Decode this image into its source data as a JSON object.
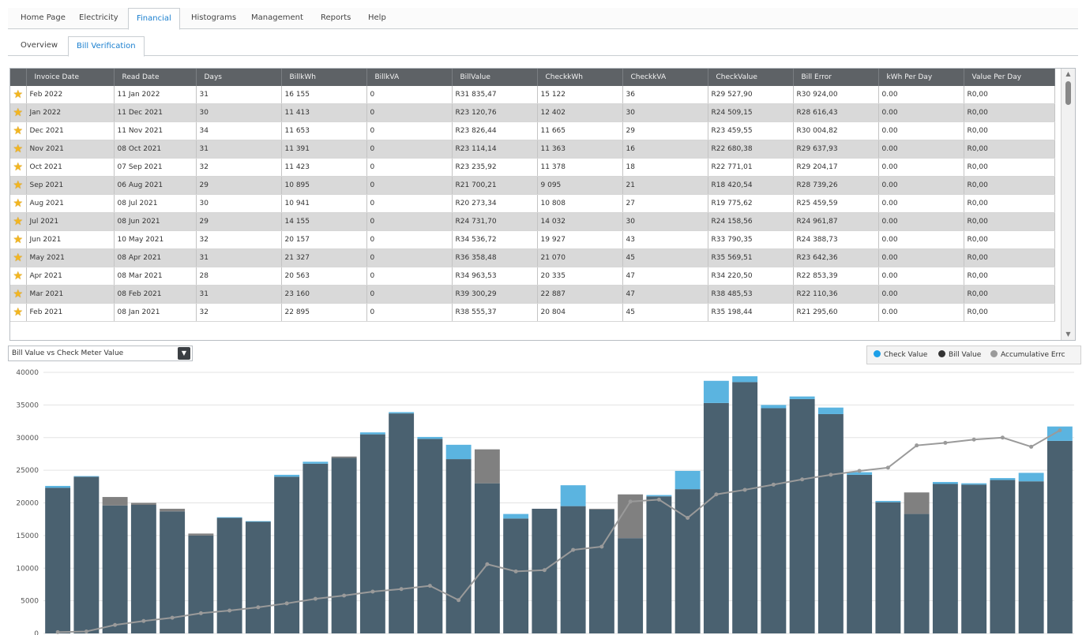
{
  "nav": {
    "tabs": [
      {
        "label": "Home Page"
      },
      {
        "label": "Electricity"
      },
      {
        "label": "Financial"
      },
      {
        "label": "Histograms"
      },
      {
        "label": "Management"
      },
      {
        "label": "Reports"
      },
      {
        "label": "Help"
      }
    ],
    "active": "Financial"
  },
  "subnav": {
    "tabs": [
      {
        "label": "Overview"
      },
      {
        "label": "Bill Verification"
      }
    ],
    "active": "Bill Verification"
  },
  "table": {
    "columns": [
      "Invoice Date",
      "Read Date",
      "Days",
      "BillkWh",
      "BillkVA",
      "BillValue",
      "CheckkWh",
      "CheckkVA",
      "CheckValue",
      "Bill Error",
      "kWh Per Day",
      "Value Per Day"
    ],
    "rows": [
      [
        "Feb 2022",
        "11 Jan 2022",
        "31",
        "16 155",
        "0",
        "R31 835,47",
        "15 122",
        "36",
        "R29 527,90",
        "R30 924,00",
        "0.00",
        "R0,00"
      ],
      [
        "Jan 2022",
        "11 Dec 2021",
        "30",
        "11 413",
        "0",
        "R23 120,76",
        "12 402",
        "30",
        "R24 509,15",
        "R28 616,43",
        "0.00",
        "R0,00"
      ],
      [
        "Dec 2021",
        "11 Nov 2021",
        "34",
        "11 653",
        "0",
        "R23 826,44",
        "11 665",
        "29",
        "R23 459,55",
        "R30 004,82",
        "0.00",
        "R0,00"
      ],
      [
        "Nov 2021",
        "08 Oct 2021",
        "31",
        "11 391",
        "0",
        "R23 114,14",
        "11 363",
        "16",
        "R22 680,38",
        "R29 637,93",
        "0.00",
        "R0,00"
      ],
      [
        "Oct 2021",
        "07 Sep 2021",
        "32",
        "11 423",
        "0",
        "R23 235,92",
        "11 378",
        "18",
        "R22 771,01",
        "R29 204,17",
        "0.00",
        "R0,00"
      ],
      [
        "Sep 2021",
        "06 Aug 2021",
        "29",
        "10 895",
        "0",
        "R21 700,21",
        "9 095",
        "21",
        "R18 420,54",
        "R28 739,26",
        "0.00",
        "R0,00"
      ],
      [
        "Aug 2021",
        "08 Jul 2021",
        "30",
        "10 941",
        "0",
        "R20 273,34",
        "10 808",
        "27",
        "R19 775,62",
        "R25 459,59",
        "0.00",
        "R0,00"
      ],
      [
        "Jul 2021",
        "08 Jun 2021",
        "29",
        "14 155",
        "0",
        "R24 731,70",
        "14 032",
        "30",
        "R24 158,56",
        "R24 961,87",
        "0.00",
        "R0,00"
      ],
      [
        "Jun 2021",
        "10 May 2021",
        "32",
        "20 157",
        "0",
        "R34 536,72",
        "19 927",
        "43",
        "R33 790,35",
        "R24 388,73",
        "0.00",
        "R0,00"
      ],
      [
        "May 2021",
        "08 Apr 2021",
        "31",
        "21 327",
        "0",
        "R36 358,48",
        "21 070",
        "45",
        "R35 569,51",
        "R23 642,36",
        "0.00",
        "R0,00"
      ],
      [
        "Apr 2021",
        "08 Mar 2021",
        "28",
        "20 563",
        "0",
        "R34 963,53",
        "20 335",
        "47",
        "R34 220,50",
        "R22 853,39",
        "0.00",
        "R0,00"
      ],
      [
        "Mar 2021",
        "08 Feb 2021",
        "31",
        "23 160",
        "0",
        "R39 300,29",
        "22 887",
        "47",
        "R38 485,53",
        "R22 110,36",
        "0.00",
        "R0,00"
      ],
      [
        "Feb 2021",
        "08 Jan 2021",
        "32",
        "22 895",
        "0",
        "R38 555,37",
        "20 804",
        "45",
        "R35 198,44",
        "R21 295,60",
        "0.00",
        "R0,00"
      ]
    ]
  },
  "selector": {
    "value": "Bill Value vs Check Meter Value"
  },
  "legend": {
    "check": "Check Value",
    "bill": "Bill Value",
    "accum": "Accumulative Errc"
  },
  "colors": {
    "bill": "#4a6170",
    "check": "#5bb4e0",
    "accum": "#808080",
    "header": "#5e6266",
    "active_tab": "#1a7fcf"
  },
  "chart_data": {
    "type": "bar",
    "ylim": [
      0,
      40000
    ],
    "yticks": [
      0,
      5000,
      10000,
      15000,
      20000,
      25000,
      30000,
      35000,
      40000
    ],
    "series": [
      {
        "name": "Check Value",
        "values": [
          22600,
          24100,
          19600,
          19700,
          18700,
          15000,
          17800,
          17200,
          24300,
          26300,
          26900,
          30800,
          33900,
          30100,
          28900,
          23000,
          18300,
          19100,
          22700,
          19000,
          14600,
          21200,
          24900,
          38700,
          39400,
          35000,
          36300,
          34600,
          24700,
          20300,
          18300,
          23200,
          23000,
          23800,
          24600,
          31700
        ]
      },
      {
        "name": "Bill Value",
        "values": [
          22300,
          24000,
          20900,
          20000,
          19100,
          15300,
          17700,
          17100,
          24000,
          26000,
          27100,
          30500,
          33700,
          29800,
          26700,
          28200,
          17600,
          19100,
          19500,
          19100,
          21300,
          21000,
          22100,
          35300,
          38500,
          34500,
          35900,
          33600,
          24300,
          20100,
          21600,
          22900,
          22800,
          23500,
          23300,
          29500
        ]
      },
      {
        "name": "Accumulative Error",
        "values": [
          200,
          300,
          1300,
          1900,
          2400,
          3100,
          3500,
          4000,
          4600,
          5300,
          5800,
          6400,
          6800,
          7300,
          5100,
          10600,
          9500,
          9700,
          12800,
          13300,
          20200,
          20500,
          17700,
          21300,
          22000,
          22800,
          23600,
          24300,
          24900,
          25400,
          28800,
          29200,
          29700,
          30000,
          28600,
          31100
        ]
      }
    ]
  }
}
